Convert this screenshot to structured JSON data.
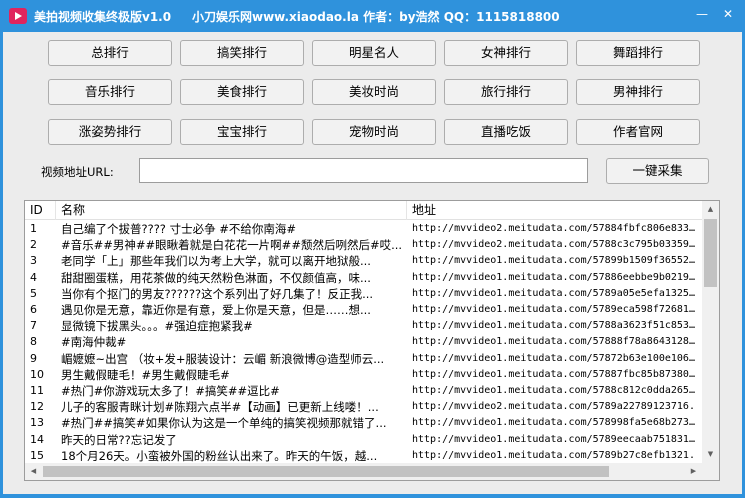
{
  "window": {
    "title": "美拍视频收集终极版v1.0",
    "site_info": "小刀娱乐网www.xiaodao.la  作者：by浩然  QQ：1115818800",
    "min_label": "—",
    "close_label": "✕"
  },
  "category_buttons": [
    [
      "总排行",
      "搞笑排行",
      "明星名人",
      "女神排行",
      "舞蹈排行"
    ],
    [
      "音乐排行",
      "美食排行",
      "美妆时尚",
      "旅行排行",
      "男神排行"
    ],
    [
      "涨姿势排行",
      "宝宝排行",
      "宠物时尚",
      "直播吃饭",
      "作者官网"
    ]
  ],
  "url_form": {
    "label": "视频地址URL:",
    "value": "",
    "collect_label": "一键采集"
  },
  "list": {
    "headers": [
      "ID",
      "名称",
      "地址"
    ],
    "rows": [
      [
        "1",
        "自己编了个拔普???? 寸士必争 #不给你南海#",
        "http://mvvideo2.meitudata.com/57884fbfc806e8338."
      ],
      [
        "2",
        "#音乐##男神##眼瞅着就是白花花一片啊##颓然后咧然后#哎...",
        "http://mvvideo2.meitudata.com/5788c3c795b033598."
      ],
      [
        "3",
        "老同学「上」那些年我们以为考上大学，就可以离开地狱般...",
        "http://mvvideo1.meitudata.com/57899b1509f365525."
      ],
      [
        "4",
        "甜甜圈蛋糕，用花茶做的纯天然粉色淋面，不仅颜值高，味...",
        "http://mvvideo1.meitudata.com/57886eebbe9b02195."
      ],
      [
        "5",
        "当你有个抠门的男友??????这个系列出了好几集了！反正我...",
        "http://mvvideo1.meitudata.com/5789a05e5efa1325.m"
      ],
      [
        "6",
        "遇见你是无意，靠近你是有意，爱上你是天意，但是……想...",
        "http://mvvideo1.meitudata.com/5789eca598f726819."
      ],
      [
        "7",
        "显微镜下拔黑头。。。#强迫症抱紧我#",
        "http://mvvideo1.meitudata.com/5788a3623f51c8534."
      ],
      [
        "8",
        "#南海仲裁#",
        "http://mvvideo1.meitudata.com/57888f78a86431283."
      ],
      [
        "9",
        "嵋嬷嬷~出宫 （妆+发+服装设计：云嵋 新浪微博@造型师云...",
        "http://mvvideo1.meitudata.com/57872b63e100e1069."
      ],
      [
        "10",
        "男生戴假睫毛！#男生戴假睫毛#",
        "http://mvvideo1.meitudata.com/57887fbc85b873805."
      ],
      [
        "11",
        "#热门#你游戏玩太多了！#搞笑##逗比#",
        "http://mvvideo1.meitudata.com/5788c812c0dda2659."
      ],
      [
        "12",
        "儿子的客服青眯计划#陈翔六点半#【动画】已更新上线喽！...",
        "http://mvvideo2.meitudata.com/5789a22789123716."
      ],
      [
        "13",
        "#热门##搞笑#如果你认为这是一个单纯的搞笑视频那就错了...",
        "http://mvvideo1.meitudata.com/578998fa5e68b2733."
      ],
      [
        "14",
        "昨天的日常??忘记发了",
        "http://mvvideo1.meitudata.com/5789eecaab7518319."
      ],
      [
        "15",
        "18个月26天。小蛮被外国的粉丝认出来了。昨天的午饭，越...",
        "http://mvvideo1.meitudata.com/5789b27c8efb1321."
      ]
    ]
  }
}
